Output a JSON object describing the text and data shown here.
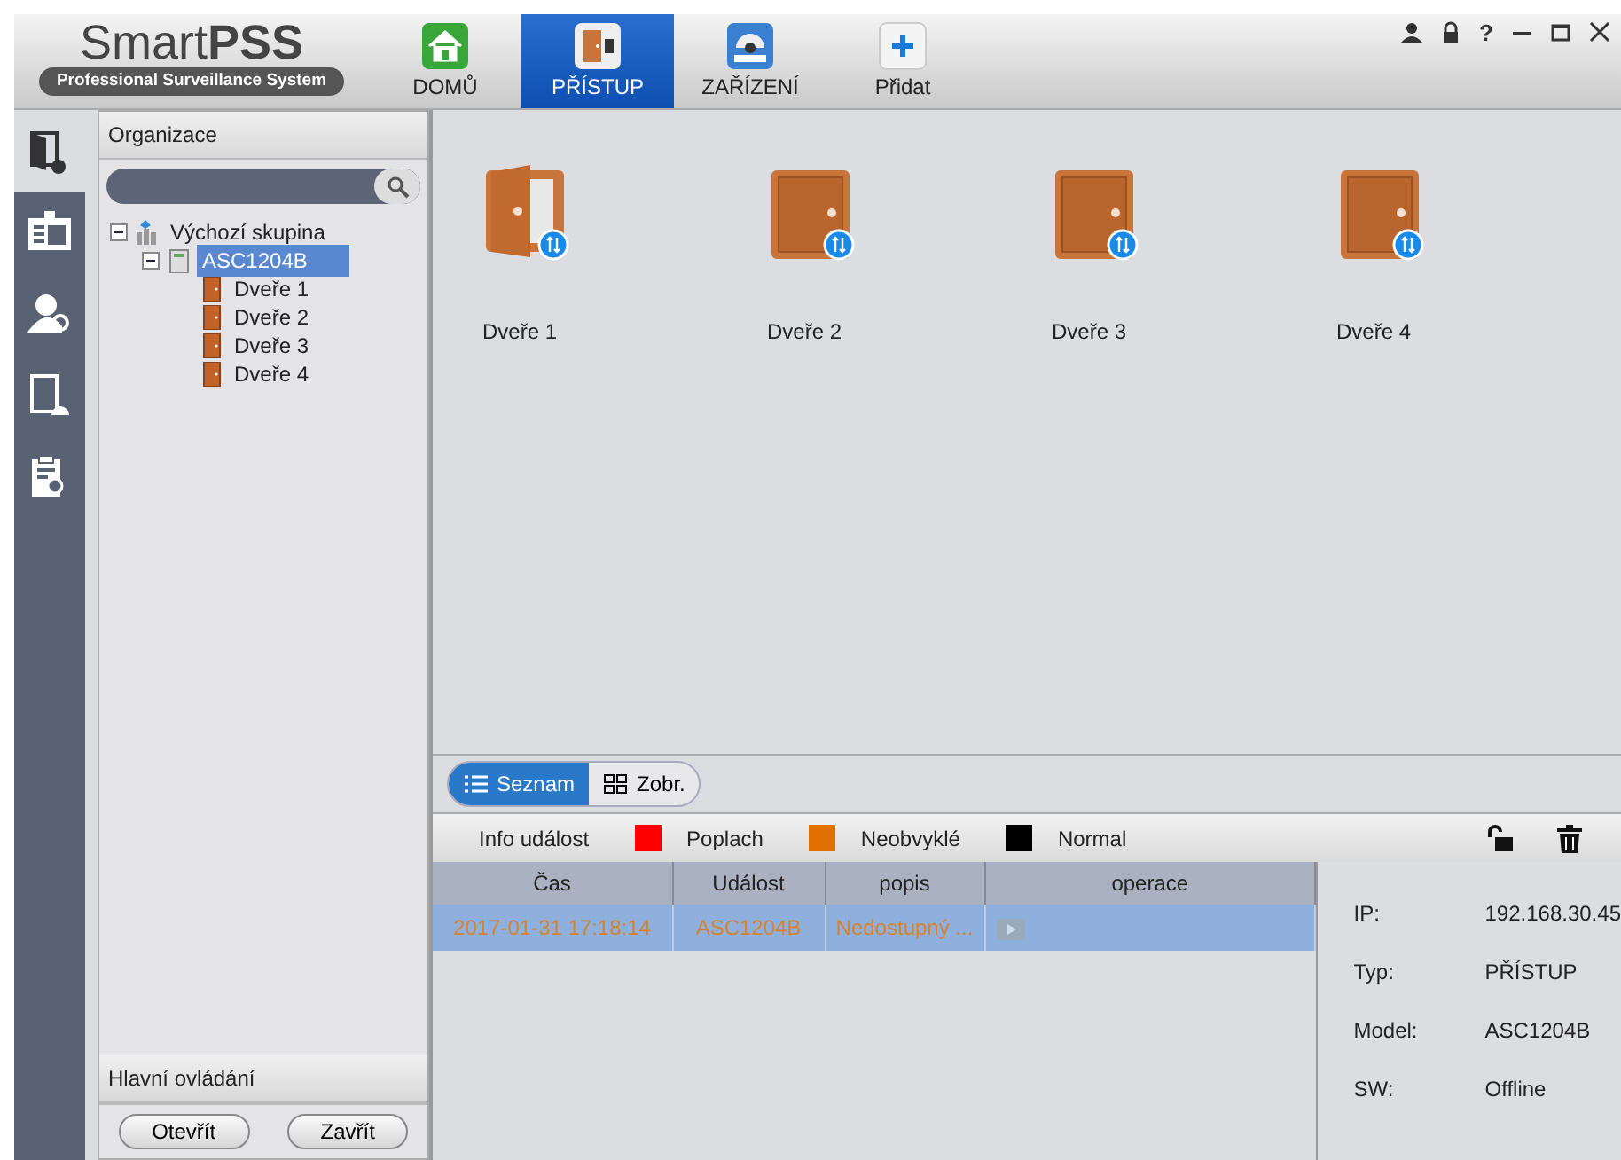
{
  "header": {
    "logo": "Smart**PSS**",
    "subtitle": "Professional Surveillance System",
    "help": "?"
  },
  "nav_tabs": [
    {
      "label": "DOMŮ",
      "kind": "home",
      "selected": false
    },
    {
      "label": "PŘÍSTUP",
      "kind": "access",
      "selected": true
    },
    {
      "label": "ZAŘÍZENÍ",
      "kind": "device",
      "selected": false
    },
    {
      "label": "Přidat",
      "kind": "add",
      "selected": false
    }
  ],
  "rail": [
    {
      "kind": "door",
      "selected": true
    },
    {
      "kind": "card",
      "selected": false
    },
    {
      "kind": "user-key",
      "selected": false
    },
    {
      "kind": "door-alarm",
      "selected": false
    },
    {
      "kind": "clipboard-search",
      "selected": false
    }
  ],
  "organization": {
    "title": "Organizace",
    "tree": [
      {
        "label": "Výchozí skupina",
        "kind": "group",
        "expanded": true,
        "selected": false,
        "children": [
          {
            "label": "ASC1204B",
            "kind": "device",
            "expanded": true,
            "selected": true,
            "children": [
              {
                "label": "Dveře 1",
                "kind": "door",
                "selected": false
              },
              {
                "label": "Dveře 2",
                "kind": "door",
                "selected": false
              },
              {
                "label": "Dveře 3",
                "kind": "door",
                "selected": false
              },
              {
                "label": "Dveře 4",
                "kind": "door",
                "selected": false
              }
            ]
          }
        ]
      }
    ]
  },
  "main_control": {
    "title": "Hlavní ovládání",
    "buttons": [
      "Otevřít",
      "Zavřít"
    ]
  },
  "doors": [
    {
      "label": "Dveře 1",
      "open": true
    },
    {
      "label": "Dveře 2",
      "open": false
    },
    {
      "label": "Dveře 3",
      "open": false
    },
    {
      "label": "Dveře 4",
      "open": false
    }
  ],
  "view_toggle": [
    {
      "label": "Seznam",
      "kind": "list",
      "selected": true
    },
    {
      "label": "Zobr.",
      "kind": "grid",
      "selected": false
    }
  ],
  "event_legend": {
    "title": "Info událost",
    "items": [
      {
        "label": "Poplach",
        "color": "#ff0000"
      },
      {
        "label": "Neobvyklé",
        "color": "#e07000"
      },
      {
        "label": "Normal",
        "color": "#000000"
      }
    ]
  },
  "events": {
    "columns": [
      "Čas",
      "Událost",
      "popis",
      "operace"
    ],
    "rows": [
      {
        "cells": [
          "2017-01-31 17:18:14",
          "ASC1204B",
          "Nedostupný ..."
        ],
        "color": "#d9822b",
        "selected": true
      }
    ]
  },
  "device_info": [
    {
      "label": "IP:",
      "value": "192.168.30.45"
    },
    {
      "label": "Typ:",
      "value": "PŘÍSTUP"
    },
    {
      "label": "Model:",
      "value": "ASC1204B"
    },
    {
      "label": "SW:",
      "value": "Offline"
    }
  ]
}
